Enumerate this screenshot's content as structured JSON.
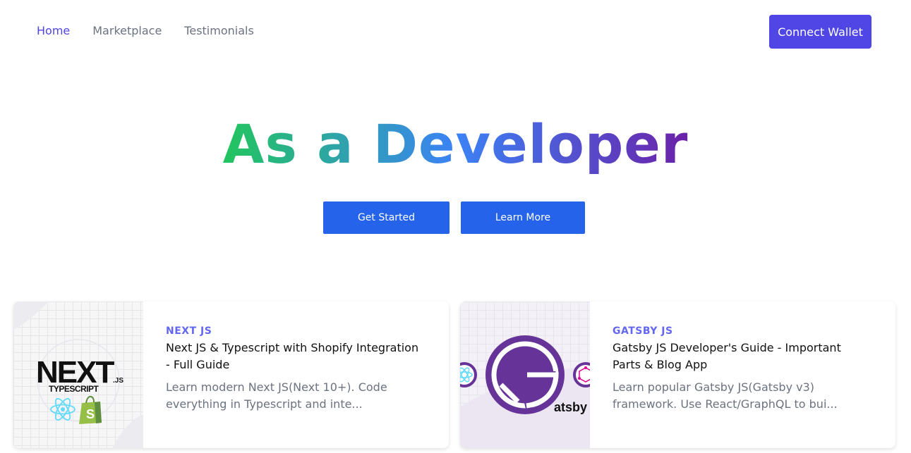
{
  "nav": {
    "links": [
      {
        "label": "Home"
      },
      {
        "label": "Marketplace"
      },
      {
        "label": "Testimonials"
      }
    ],
    "connect_label": "Connect Wallet"
  },
  "hero": {
    "title": "As a Developer",
    "primary_label": "Get Started",
    "secondary_label": "Learn More"
  },
  "colors": {
    "accent": "#4f46e5",
    "button_blue": "#2563eb",
    "gradient": [
      "#22c55e",
      "#3b82f6",
      "#6b21a8"
    ]
  },
  "cards": [
    {
      "tag": "NEXT JS",
      "title": "Next JS & Typescript with Shopify Integration - Full Guide",
      "description": "Learn modern Next JS(Next 10+). Code everything in Typescript and inte...",
      "thumb": {
        "logo_text": "NEXT",
        "logo_suffix": ".JS",
        "logo_sub": "TYPESCRIPT",
        "icons": [
          "react-icon",
          "shopify-bag-icon"
        ]
      }
    },
    {
      "tag": "GATSBY JS",
      "title": "Gatsby JS Developer's Guide - Important Parts & Blog App",
      "description": "Learn popular Gatsby JS(Gatsby v3) framework. Use React/GraphQL to bui...",
      "thumb": {
        "logo_text": "atsby",
        "icons": [
          "gatsby-logo-icon",
          "react-icon",
          "graphql-icon"
        ]
      }
    }
  ]
}
